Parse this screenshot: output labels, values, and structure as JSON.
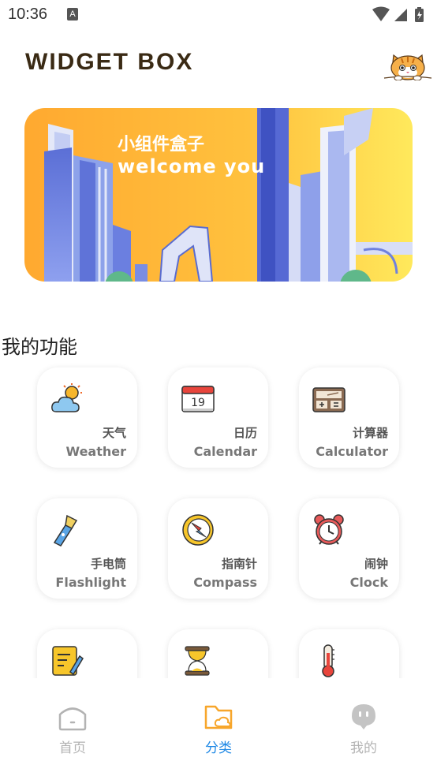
{
  "status_bar": {
    "time": "10:36",
    "notification_letter": "A"
  },
  "header": {
    "title": "WIDGET BOX"
  },
  "banner": {
    "line1": "小组件盒子",
    "line2": "welcome you"
  },
  "section": {
    "title": "我的功能"
  },
  "features": [
    {
      "cn": "天气",
      "en": "Weather",
      "icon": "weather-icon"
    },
    {
      "cn": "日历",
      "en": "Calendar",
      "icon": "calendar-icon",
      "icon_text": "19"
    },
    {
      "cn": "计算器",
      "en": "Calculator",
      "icon": "calculator-icon"
    },
    {
      "cn": "手电筒",
      "en": "Flashlight",
      "icon": "flashlight-icon"
    },
    {
      "cn": "指南针",
      "en": "Compass",
      "icon": "compass-icon"
    },
    {
      "cn": "闹钟",
      "en": "Clock",
      "icon": "alarm-clock-icon"
    },
    {
      "icon": "notepad-icon"
    },
    {
      "icon": "hourglass-icon"
    },
    {
      "icon": "thermometer-icon"
    }
  ],
  "tabbar": {
    "items": [
      {
        "label": "首页",
        "icon": "home-icon",
        "active": false
      },
      {
        "label": "分类",
        "icon": "category-folder-icon",
        "active": true
      },
      {
        "label": "我的",
        "icon": "profile-icon",
        "active": false
      }
    ],
    "active_color": "#1e88e5",
    "inactive_color": "#b3b3b3"
  },
  "colors": {
    "title": "#3a2a14",
    "banner_orange": "#ffb53b",
    "banner_yellow": "#ffe45a"
  }
}
